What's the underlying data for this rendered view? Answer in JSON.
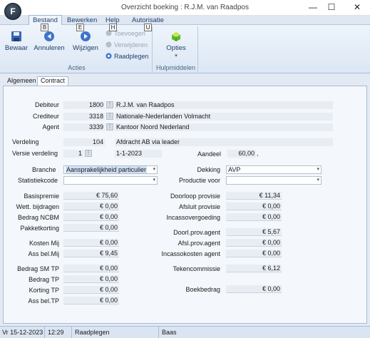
{
  "window": {
    "title": "Overzicht boeking : R.J.M. van Raadpos",
    "app_icon_letter": "F",
    "controls": {
      "minimize": "—",
      "maximize": "☐",
      "close": "✕"
    }
  },
  "menu": {
    "tabs": [
      {
        "label": "Bestand",
        "keytip": "B"
      },
      {
        "label": "Bewerken",
        "keytip": "E"
      },
      {
        "label": "Help",
        "keytip": "H"
      },
      {
        "label": "Autorisatie",
        "keytip": "U"
      }
    ]
  },
  "ribbon": {
    "acties_label": "Acties",
    "hulpmiddelen_label": "Hulpmiddelen",
    "buttons": {
      "bewaar": "Bewaar",
      "annuleren": "Annuleren",
      "wijzigen": "Wijzigen",
      "toevoegen": "Toevoegen",
      "verwijderen": "Verwijderen",
      "raadplegen": "Raadplegen",
      "opties": "Opties",
      "opties_arrow": "▾"
    }
  },
  "tabs": {
    "algemeen": "Algemeen",
    "contract": "Contract"
  },
  "form": {
    "debiteur": {
      "label": "Debiteur",
      "code": "1800",
      "name": "R.J.M. van Raadpos"
    },
    "crediteur": {
      "label": "Crediteur",
      "code": "3318",
      "name": "Nationale-Nederlanden Volmacht"
    },
    "agent": {
      "label": "Agent",
      "code": "3339",
      "name": "Kantoor Noord Nederland"
    },
    "verdeling": {
      "label": "Verdeling",
      "code": "104",
      "name": "Afdracht AB via leader"
    },
    "versie_verdeling": {
      "label": "Versie verdeling",
      "value": "1",
      "date": "1-1-2023"
    },
    "aandeel": {
      "label": "Aandeel",
      "value": "60,00",
      "suffix": ","
    },
    "branche": {
      "label": "Branche",
      "value": "Aansprakelijkheid particulier"
    },
    "statistiekcode": {
      "label": "Statistiekcode",
      "value": ""
    },
    "dekking": {
      "label": "Dekking",
      "value": "AVP"
    },
    "productie_voor": {
      "label": "Productie voor",
      "value": ""
    },
    "dropdown_arrow": "▾",
    "lookup_glyph": "⋮"
  },
  "amounts_left": [
    {
      "label": "Basispremie",
      "value": "€ 75,60"
    },
    {
      "label": "Wett. bijdragen",
      "value": "€ 0,00"
    },
    {
      "label": "Bedrag NCBM",
      "value": "€ 0,00"
    },
    {
      "label": "Pakketkorting",
      "value": "€ 0,00"
    },
    {
      "label": "Kosten Mij",
      "value": "€ 0,00"
    },
    {
      "label": "Ass bel.Mij",
      "value": "€ 9,45"
    },
    {
      "label": "Bedrag SM TP",
      "value": "€ 0,00"
    },
    {
      "label": "Bedrag TP",
      "value": "€ 0,00"
    },
    {
      "label": "Korting TP",
      "value": "€ 0,00"
    },
    {
      "label": "Ass bel.TP",
      "value": "€ 0,00"
    }
  ],
  "amounts_right": [
    {
      "label": "Doorloop provisie",
      "value": "€ 11,34"
    },
    {
      "label": "Afsluit provisie",
      "value": "€ 0,00"
    },
    {
      "label": "Incassovergoeding",
      "value": "€ 0,00"
    },
    {
      "label": "Doorl.prov.agent",
      "value": "€ 5,67"
    },
    {
      "label": "Afsl.prov.agent",
      "value": "€ 0,00"
    },
    {
      "label": "Incassokosten agent",
      "value": "€ 0,00"
    },
    {
      "label": "Tekencommissie",
      "value": "€ 6,12"
    },
    {
      "label": "Boekbedrag",
      "value": "€ 0,00"
    }
  ],
  "status": {
    "version": "Vr 15-12-2023",
    "time": "12:29",
    "mode": "Raadplegen",
    "user": "Baas"
  }
}
